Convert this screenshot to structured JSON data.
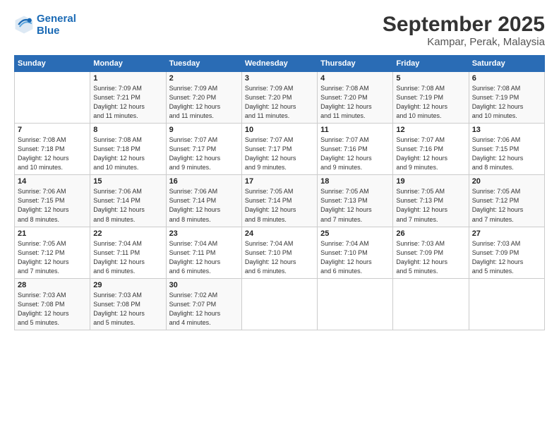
{
  "header": {
    "logo_line1": "General",
    "logo_line2": "Blue",
    "title": "September 2025",
    "subtitle": "Kampar, Perak, Malaysia"
  },
  "weekdays": [
    "Sunday",
    "Monday",
    "Tuesday",
    "Wednesday",
    "Thursday",
    "Friday",
    "Saturday"
  ],
  "weeks": [
    [
      {
        "day": "",
        "detail": ""
      },
      {
        "day": "1",
        "detail": "Sunrise: 7:09 AM\nSunset: 7:21 PM\nDaylight: 12 hours\nand 11 minutes."
      },
      {
        "day": "2",
        "detail": "Sunrise: 7:09 AM\nSunset: 7:20 PM\nDaylight: 12 hours\nand 11 minutes."
      },
      {
        "day": "3",
        "detail": "Sunrise: 7:09 AM\nSunset: 7:20 PM\nDaylight: 12 hours\nand 11 minutes."
      },
      {
        "day": "4",
        "detail": "Sunrise: 7:08 AM\nSunset: 7:20 PM\nDaylight: 12 hours\nand 11 minutes."
      },
      {
        "day": "5",
        "detail": "Sunrise: 7:08 AM\nSunset: 7:19 PM\nDaylight: 12 hours\nand 10 minutes."
      },
      {
        "day": "6",
        "detail": "Sunrise: 7:08 AM\nSunset: 7:19 PM\nDaylight: 12 hours\nand 10 minutes."
      }
    ],
    [
      {
        "day": "7",
        "detail": "Sunrise: 7:08 AM\nSunset: 7:18 PM\nDaylight: 12 hours\nand 10 minutes."
      },
      {
        "day": "8",
        "detail": "Sunrise: 7:08 AM\nSunset: 7:18 PM\nDaylight: 12 hours\nand 10 minutes."
      },
      {
        "day": "9",
        "detail": "Sunrise: 7:07 AM\nSunset: 7:17 PM\nDaylight: 12 hours\nand 9 minutes."
      },
      {
        "day": "10",
        "detail": "Sunrise: 7:07 AM\nSunset: 7:17 PM\nDaylight: 12 hours\nand 9 minutes."
      },
      {
        "day": "11",
        "detail": "Sunrise: 7:07 AM\nSunset: 7:16 PM\nDaylight: 12 hours\nand 9 minutes."
      },
      {
        "day": "12",
        "detail": "Sunrise: 7:07 AM\nSunset: 7:16 PM\nDaylight: 12 hours\nand 9 minutes."
      },
      {
        "day": "13",
        "detail": "Sunrise: 7:06 AM\nSunset: 7:15 PM\nDaylight: 12 hours\nand 8 minutes."
      }
    ],
    [
      {
        "day": "14",
        "detail": "Sunrise: 7:06 AM\nSunset: 7:15 PM\nDaylight: 12 hours\nand 8 minutes."
      },
      {
        "day": "15",
        "detail": "Sunrise: 7:06 AM\nSunset: 7:14 PM\nDaylight: 12 hours\nand 8 minutes."
      },
      {
        "day": "16",
        "detail": "Sunrise: 7:06 AM\nSunset: 7:14 PM\nDaylight: 12 hours\nand 8 minutes."
      },
      {
        "day": "17",
        "detail": "Sunrise: 7:05 AM\nSunset: 7:14 PM\nDaylight: 12 hours\nand 8 minutes."
      },
      {
        "day": "18",
        "detail": "Sunrise: 7:05 AM\nSunset: 7:13 PM\nDaylight: 12 hours\nand 7 minutes."
      },
      {
        "day": "19",
        "detail": "Sunrise: 7:05 AM\nSunset: 7:13 PM\nDaylight: 12 hours\nand 7 minutes."
      },
      {
        "day": "20",
        "detail": "Sunrise: 7:05 AM\nSunset: 7:12 PM\nDaylight: 12 hours\nand 7 minutes."
      }
    ],
    [
      {
        "day": "21",
        "detail": "Sunrise: 7:05 AM\nSunset: 7:12 PM\nDaylight: 12 hours\nand 7 minutes."
      },
      {
        "day": "22",
        "detail": "Sunrise: 7:04 AM\nSunset: 7:11 PM\nDaylight: 12 hours\nand 6 minutes."
      },
      {
        "day": "23",
        "detail": "Sunrise: 7:04 AM\nSunset: 7:11 PM\nDaylight: 12 hours\nand 6 minutes."
      },
      {
        "day": "24",
        "detail": "Sunrise: 7:04 AM\nSunset: 7:10 PM\nDaylight: 12 hours\nand 6 minutes."
      },
      {
        "day": "25",
        "detail": "Sunrise: 7:04 AM\nSunset: 7:10 PM\nDaylight: 12 hours\nand 6 minutes."
      },
      {
        "day": "26",
        "detail": "Sunrise: 7:03 AM\nSunset: 7:09 PM\nDaylight: 12 hours\nand 5 minutes."
      },
      {
        "day": "27",
        "detail": "Sunrise: 7:03 AM\nSunset: 7:09 PM\nDaylight: 12 hours\nand 5 minutes."
      }
    ],
    [
      {
        "day": "28",
        "detail": "Sunrise: 7:03 AM\nSunset: 7:08 PM\nDaylight: 12 hours\nand 5 minutes."
      },
      {
        "day": "29",
        "detail": "Sunrise: 7:03 AM\nSunset: 7:08 PM\nDaylight: 12 hours\nand 5 minutes."
      },
      {
        "day": "30",
        "detail": "Sunrise: 7:02 AM\nSunset: 7:07 PM\nDaylight: 12 hours\nand 4 minutes."
      },
      {
        "day": "",
        "detail": ""
      },
      {
        "day": "",
        "detail": ""
      },
      {
        "day": "",
        "detail": ""
      },
      {
        "day": "",
        "detail": ""
      }
    ]
  ]
}
